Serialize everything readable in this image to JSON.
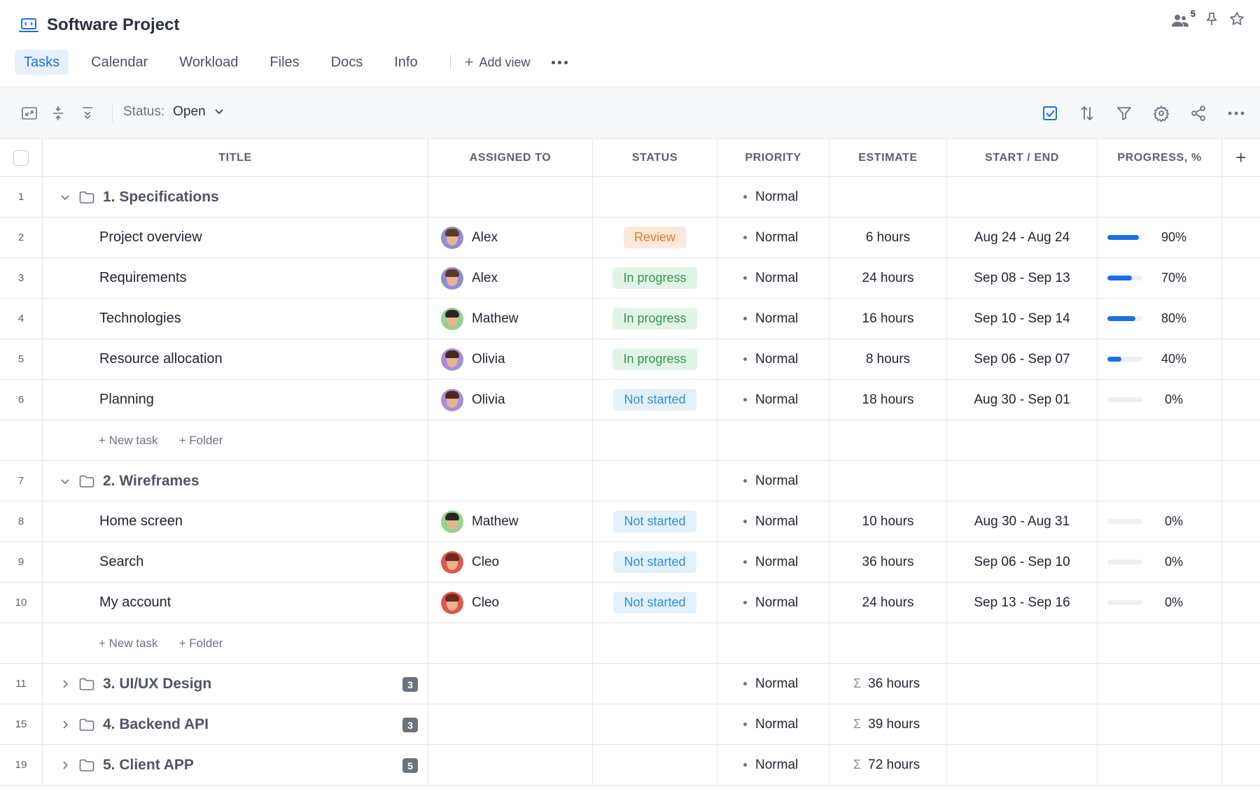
{
  "app": {
    "title": "Software Project",
    "members_count": "5"
  },
  "tabs": [
    {
      "label": "Tasks",
      "active": true
    },
    {
      "label": "Calendar"
    },
    {
      "label": "Workload"
    },
    {
      "label": "Files"
    },
    {
      "label": "Docs"
    },
    {
      "label": "Info"
    }
  ],
  "add_view_label": "Add view",
  "toolbar": {
    "status_label": "Status:",
    "status_value": "Open"
  },
  "columns": [
    "TITLE",
    "ASSIGNED TO",
    "STATUS",
    "PRIORITY",
    "ESTIMATE",
    "START / END",
    "PROGRESS, %"
  ],
  "add_task_label": "+ New task",
  "add_folder_label": "+ Folder",
  "status_colors": {
    "Review": {
      "bg": "#fde9dc",
      "fg": "#e07a2a"
    },
    "In progress": {
      "bg": "#e1f5e6",
      "fg": "#2e9a4b"
    },
    "Not started": {
      "bg": "#e3f1fc",
      "fg": "#2e8fd8"
    }
  },
  "assignee_colors": {
    "Alex": {
      "bg": "#8f8cd8",
      "hair": "#5b3b24"
    },
    "Mathew": {
      "bg": "#8fd48f",
      "hair": "#2b2320"
    },
    "Olivia": {
      "bg": "#a58fdb",
      "hair": "#4a2a1c"
    },
    "Cleo": {
      "bg": "#e0574f",
      "hair": "#6b2a1a"
    }
  },
  "rows": [
    {
      "type": "folder",
      "num": "1",
      "title": "1. Specifications",
      "expanded": true,
      "priority": "Normal"
    },
    {
      "type": "task",
      "num": "2",
      "title": "Project overview",
      "assignee": "Alex",
      "status": "Review",
      "priority": "Normal",
      "estimate": "6 hours",
      "dates": "Aug 24 - Aug 24",
      "progress": "90%",
      "progress_value": 90
    },
    {
      "type": "task",
      "num": "3",
      "title": "Requirements",
      "assignee": "Alex",
      "status": "In progress",
      "priority": "Normal",
      "estimate": "24 hours",
      "dates": "Sep 08 - Sep 13",
      "progress": "70%",
      "progress_value": 70
    },
    {
      "type": "task",
      "num": "4",
      "title": "Technologies",
      "assignee": "Mathew",
      "status": "In progress",
      "priority": "Normal",
      "estimate": "16 hours",
      "dates": "Sep 10 - Sep 14",
      "progress": "80%",
      "progress_value": 80
    },
    {
      "type": "task",
      "num": "5",
      "title": "Resource allocation",
      "assignee": "Olivia",
      "status": "In progress",
      "priority": "Normal",
      "estimate": "8 hours",
      "dates": "Sep 06 - Sep 07",
      "progress": "40%",
      "progress_value": 40
    },
    {
      "type": "task",
      "num": "6",
      "title": "Planning",
      "assignee": "Olivia",
      "status": "Not started",
      "priority": "Normal",
      "estimate": "18 hours",
      "dates": "Aug 30 - Sep 01",
      "progress": "0%",
      "progress_value": 0
    },
    {
      "type": "add"
    },
    {
      "type": "folder",
      "num": "7",
      "title": "2. Wireframes",
      "expanded": true,
      "priority": "Normal"
    },
    {
      "type": "task",
      "num": "8",
      "title": "Home screen",
      "assignee": "Mathew",
      "status": "Not started",
      "priority": "Normal",
      "estimate": "10 hours",
      "dates": "Aug 30 - Aug 31",
      "progress": "0%",
      "progress_value": 0
    },
    {
      "type": "task",
      "num": "9",
      "title": "Search",
      "assignee": "Cleo",
      "status": "Not started",
      "priority": "Normal",
      "estimate": "36 hours",
      "dates": "Sep 06 - Sep 10",
      "progress": "0%",
      "progress_value": 0
    },
    {
      "type": "task",
      "num": "10",
      "title": "My account",
      "assignee": "Cleo",
      "status": "Not started",
      "priority": "Normal",
      "estimate": "24 hours",
      "dates": "Sep 13 - Sep 16",
      "progress": "0%",
      "progress_value": 0
    },
    {
      "type": "add"
    },
    {
      "type": "folder",
      "num": "11",
      "title": "3. UI/UX Design",
      "expanded": false,
      "count": "3",
      "priority": "Normal",
      "estimate_sum": "36 hours"
    },
    {
      "type": "folder",
      "num": "15",
      "title": "4. Backend API",
      "expanded": false,
      "count": "3",
      "priority": "Normal",
      "estimate_sum": "39 hours"
    },
    {
      "type": "folder",
      "num": "19",
      "title": "5. Client APP",
      "expanded": false,
      "count": "5",
      "priority": "Normal",
      "estimate_sum": "72 hours"
    }
  ]
}
